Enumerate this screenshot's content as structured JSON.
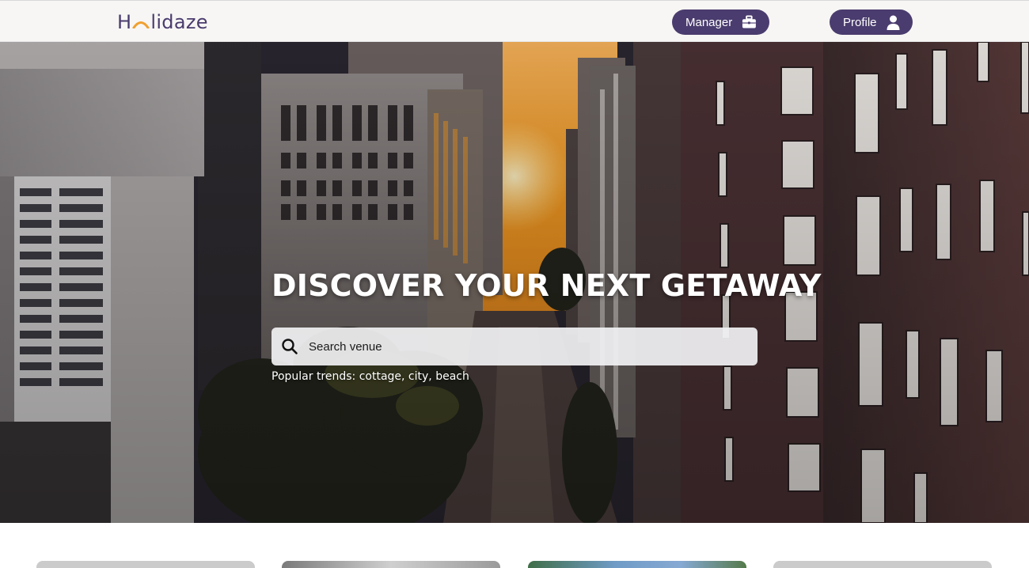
{
  "header": {
    "logo_text_left": "H",
    "logo_text_right": "lidaze",
    "manager_label": "Manager",
    "manager_icon": "briefcase-icon",
    "profile_label": "Profile",
    "profile_icon": "user-icon",
    "brand_color": "#4a3c6e"
  },
  "hero": {
    "title": "DISCOVER YOUR NEXT GETAWAY",
    "search_placeholder": "Search venue",
    "search_icon": "search-icon",
    "trends_text": "Popular trends: cottage, city, beach"
  },
  "cards": [
    {
      "name": "venue-card-1"
    },
    {
      "name": "venue-card-2"
    },
    {
      "name": "venue-card-3"
    },
    {
      "name": "venue-card-4"
    }
  ]
}
